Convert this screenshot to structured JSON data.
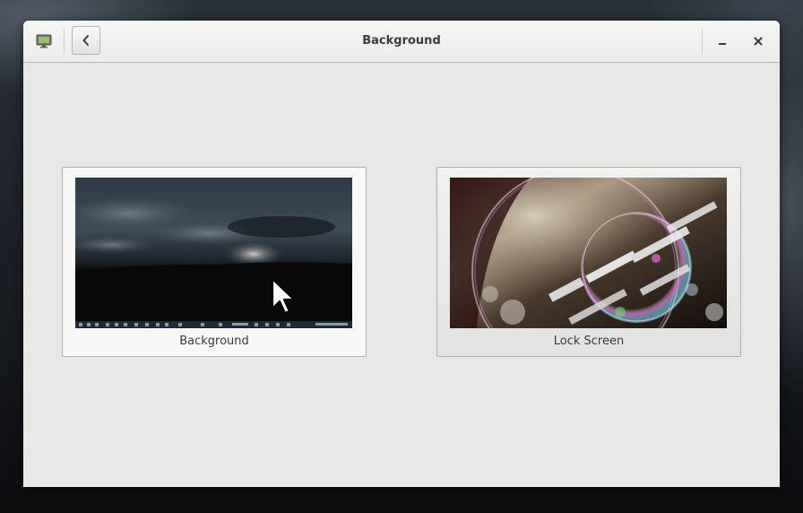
{
  "window": {
    "title": "Background",
    "app_icon": "display-settings-icon",
    "back_icon": "chevron-left-icon",
    "minimize_icon": "minimize-icon",
    "close_icon": "close-icon"
  },
  "cards": [
    {
      "label": "Background",
      "thumbnail": "desktop-wallpaper-thumbnail"
    },
    {
      "label": "Lock Screen",
      "thumbnail": "lock-screen-thumbnail"
    }
  ],
  "colors": {
    "window_bg": "#e8e8e7",
    "header_bg": "#f0f0ef",
    "text": "#3c3c3c",
    "border": "#b2b2b0"
  },
  "cursor": "arrow-cursor-icon"
}
